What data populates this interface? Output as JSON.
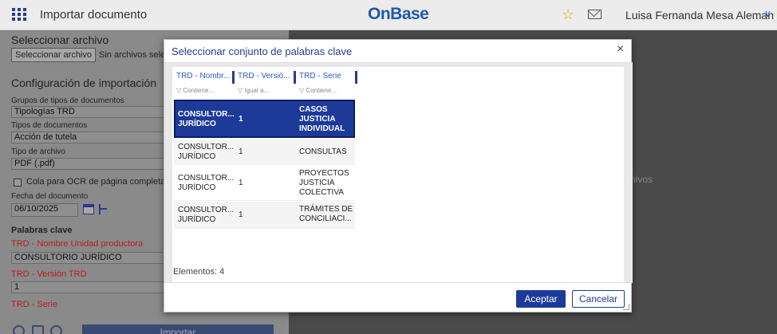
{
  "header": {
    "app_title": "Importar documento",
    "brand": "OnBase",
    "brand_mark": "·",
    "user_name": "Luisa Fernanda Mesa Aleman",
    "chevron": "∨",
    "star": "☆"
  },
  "left_panel": {
    "select_file_title": "Seleccionar archivo",
    "select_file_button": "Seleccionar archivo",
    "no_files_text": "Sin archivos sele",
    "config_title": "Configuración de importación",
    "doc_type_groups_label": "Grupos de tipos de documentos",
    "doc_type_groups_value": "Tipologías TRD",
    "doc_types_label": "Tipos de documentos",
    "doc_types_value": "Acción de tutela",
    "file_type_label": "Tipo de archivo",
    "file_type_value": "PDF (.pdf)",
    "ocr_label": "Cola para OCR de página completa",
    "date_label": "Fecha del documento",
    "date_value": "06/10/2025",
    "keywords_title": "Palabras clave",
    "kw1_label": "TRD - Nombre Unidad productora",
    "kw1_value": "CONSULTORIO JURÍDICO",
    "kw2_label": "TRD - Versión TRD",
    "kw2_value": "1",
    "kw3_label": "TRD - Serie",
    "import_button": "Importar"
  },
  "right_panel": {
    "partial_text": "hivos"
  },
  "modal": {
    "title": "Seleccionar conjunto de palabras clave",
    "close": "×",
    "columns": [
      {
        "header": "TRD - Nombr...",
        "filter": "▽ Contiene..."
      },
      {
        "header": "TRD - Versió...",
        "filter": "▽ Igual a..."
      },
      {
        "header": "TRD - Serie",
        "filter": "▽ Contiene..."
      }
    ],
    "rows": [
      {
        "name": "CONSULTOR...\nJURÍDICO",
        "version": "1",
        "serie": "CASOS\nJUSTICIA\nINDIVIDUAL"
      },
      {
        "name": "CONSULTOR...\nJURÍDICO",
        "version": "1",
        "serie": "CONSULTAS"
      },
      {
        "name": "CONSULTOR...\nJURÍDICO",
        "version": "1",
        "serie": "PROYECTOS\nJUSTICIA\nCOLECTIVA"
      },
      {
        "name": "CONSULTOR...\nJURÍDICO",
        "version": "1",
        "serie": "TRÁMITES DE\nCONCILIACI..."
      }
    ],
    "count_text": "Elementos: 4",
    "accept_button": "Aceptar",
    "cancel_button": "Cancelar"
  }
}
